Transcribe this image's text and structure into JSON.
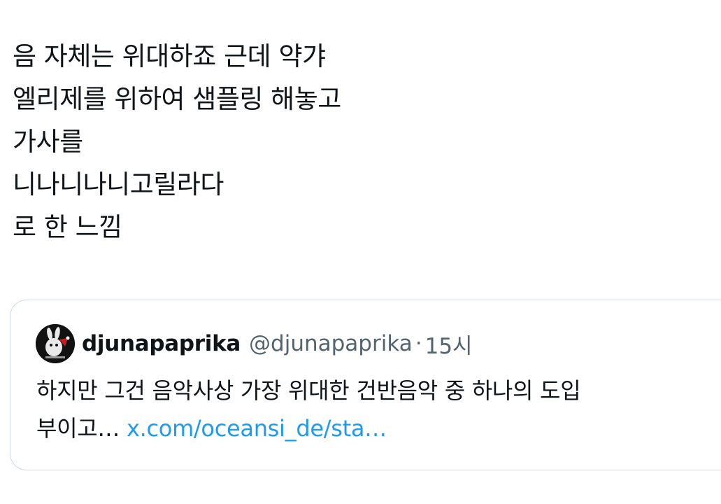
{
  "tweet": {
    "lines": [
      "음 자체는 위대하죠 근데 약갸",
      "엘리제를 위하여 샘플링 해놓고",
      "가사를",
      "니나니나니고릴라다",
      "로 한 느낌"
    ]
  },
  "quote": {
    "display_name": "djunapaprika",
    "handle": "@djunapaprika",
    "separator": "·",
    "timestamp": "15시",
    "text_line1": "하지만 그건 음악사상 가장 위대한 건반음악 중 하나의 도입",
    "text_line2_prefix": "부이고…",
    "link_text": "x.com/oceansi_de/sta…"
  },
  "colors": {
    "text": "#0f1419",
    "secondary": "#536471",
    "link": "#1d9bf0",
    "border": "#cfd9de",
    "background": "#ffffff"
  },
  "icons": {
    "avatar": "avatar-image"
  }
}
